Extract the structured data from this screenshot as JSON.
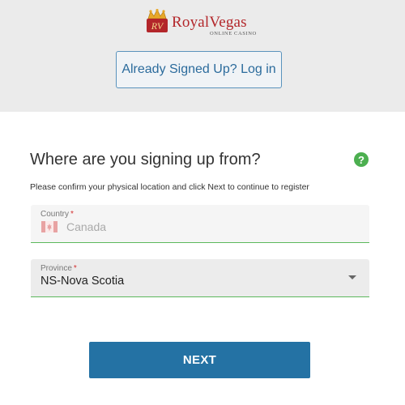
{
  "header": {
    "logo_text": "RoyalVegas",
    "logo_subtext": "ONLINE CASINO",
    "logo_mark_text": "RV",
    "login_button_label": "Already Signed Up? Log in"
  },
  "form": {
    "title": "Where are you signing up from?",
    "help_icon_glyph": "?",
    "subtitle": "Please confirm your physical location and click Next to continue to register",
    "country": {
      "label": "Country",
      "required_mark": "*",
      "value": "Canada",
      "flag_icon": "canada-flag-icon"
    },
    "province": {
      "label": "Province",
      "required_mark": "*",
      "value": "NS-Nova Scotia"
    },
    "next_button_label": "NEXT"
  },
  "colors": {
    "header_bg": "#ebebeb",
    "brand_red": "#b3262a",
    "login_blue": "#2b6b9c",
    "help_green": "#4caf50",
    "field_underline_green": "#5cb85c",
    "next_button_blue": "#2472a4"
  }
}
